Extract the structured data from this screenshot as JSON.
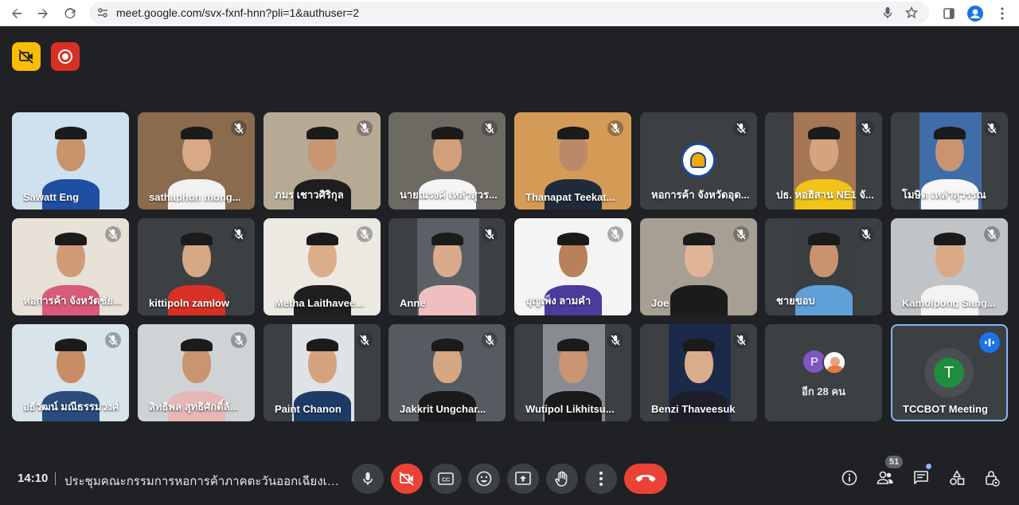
{
  "browser": {
    "url": "meet.google.com/svx-fxnf-hnn?pli=1&authuser=2"
  },
  "participants": [
    {
      "name": "Sawatt Eng",
      "muted": false
    },
    {
      "name": "sathaphon mong...",
      "muted": true
    },
    {
      "name": "ภมร เชาวศิริกุล",
      "muted": true
    },
    {
      "name": "นายณรงค์ เหล่าสุวร...",
      "muted": true
    },
    {
      "name": "Thanapat Teekat...",
      "muted": true
    },
    {
      "name": "หอการค้า จังหวัดอุด...",
      "muted": true
    },
    {
      "name": "ปธ. หอฮิสาน NE1 จั...",
      "muted": true
    },
    {
      "name": "โมษิต เหล่าสุวรรณ",
      "muted": true
    },
    {
      "name": "หอการค้า จังหวัดชัย...",
      "muted": true
    },
    {
      "name": "kittipoln zamlow",
      "muted": true
    },
    {
      "name": "Metha Laithavee...",
      "muted": true
    },
    {
      "name": "Anne",
      "muted": true
    },
    {
      "name": "บุญเพ็ง ลามคำ",
      "muted": true
    },
    {
      "name": "Joe",
      "muted": true
    },
    {
      "name": "ชายขอบ",
      "muted": true
    },
    {
      "name": "Kamolpong Sang...",
      "muted": true
    },
    {
      "name": "อธิวัฒน์ มณีธรรมวงศ์",
      "muted": true
    },
    {
      "name": "สิทธิพล สุทธิศักดิ์ลั...",
      "muted": true
    },
    {
      "name": "Paint Chanon",
      "muted": true
    },
    {
      "name": "Jakkrit Ungchar...",
      "muted": true
    },
    {
      "name": "Wutipol Likhitsu...",
      "muted": true
    },
    {
      "name": "Benzi Thaveesuk",
      "muted": true
    }
  ],
  "others_tile": {
    "avatar_letter": "P",
    "label": "อีก 28 คน"
  },
  "self_tile": {
    "avatar_letter": "T",
    "name": "TCCBOT Meeting"
  },
  "bottom_bar": {
    "time": "14:10",
    "meeting_title": "ประชุมคณะกรรมการหอการค้าภาคตะวันออกเฉียงเหนือ...",
    "participant_count": "51"
  },
  "colors": {
    "background": "#202124",
    "tile": "#3c4043",
    "red": "#ea4335",
    "accent_blue": "#8ab4f8",
    "badge_yellow": "#fbbc04"
  },
  "icons": {
    "back": "arrow-left-icon",
    "forward": "arrow-right-icon",
    "reload": "reload-icon",
    "site_info": "tune-icon",
    "voice": "mic-icon",
    "bookmark": "star-icon",
    "sidepanel": "sidepanel-icon",
    "profile": "account-icon",
    "menu": "more-vert-icon"
  }
}
